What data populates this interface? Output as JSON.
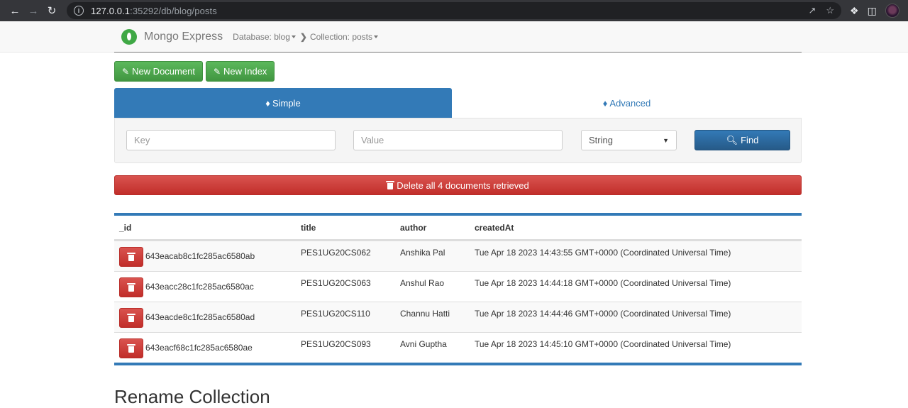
{
  "browser": {
    "url_host": "127.0.0.1",
    "url_rest": ":35292/db/blog/posts"
  },
  "navbar": {
    "brand": "Mongo Express",
    "database_label": "Database: blog",
    "collection_label": "Collection: posts"
  },
  "toolbar": {
    "new_document": "New Document",
    "new_index": "New Index"
  },
  "tabs": {
    "simple": "Simple",
    "advanced": "Advanced"
  },
  "search": {
    "key_placeholder": "Key",
    "value_placeholder": "Value",
    "type_selected": "String",
    "find_label": "Find"
  },
  "delete_all_label": "Delete all 4 documents retrieved",
  "table": {
    "headers": [
      "_id",
      "title",
      "author",
      "createdAt"
    ],
    "rows": [
      {
        "id": "643eacab8c1fc285ac6580ab",
        "title": "PES1UG20CS062",
        "author": "Anshika Pal",
        "createdAt": "Tue Apr 18 2023 14:43:55 GMT+0000 (Coordinated Universal Time)"
      },
      {
        "id": "643eacc28c1fc285ac6580ac",
        "title": "PES1UG20CS063",
        "author": "Anshul Rao",
        "createdAt": "Tue Apr 18 2023 14:44:18 GMT+0000 (Coordinated Universal Time)"
      },
      {
        "id": "643eacde8c1fc285ac6580ad",
        "title": "PES1UG20CS110",
        "author": "Channu Hatti",
        "createdAt": "Tue Apr 18 2023 14:44:46 GMT+0000 (Coordinated Universal Time)"
      },
      {
        "id": "643eacf68c1fc285ac6580ae",
        "title": "PES1UG20CS093",
        "author": "Avni Guptha",
        "createdAt": "Tue Apr 18 2023 14:45:10 GMT+0000 (Coordinated Universal Time)"
      }
    ]
  },
  "rename_section_title": "Rename Collection"
}
